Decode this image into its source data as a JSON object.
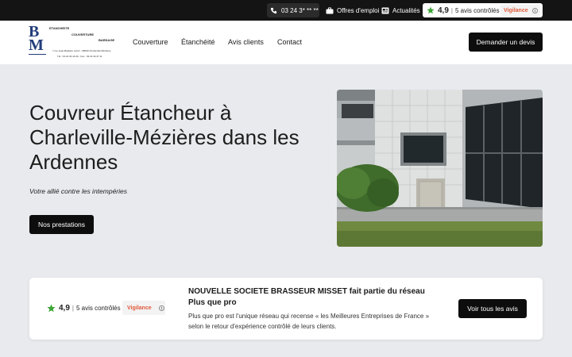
{
  "topbar": {
    "phone": "03 24 3* ** **",
    "jobs_label": "Offres d'emploi",
    "news_label": "Actualités",
    "rating_score": "4,9",
    "rating_count": "5 avis contrôlés",
    "vigilance_label": "Vigilance"
  },
  "header": {
    "logo": {
      "monogram": "BM",
      "line1": "ETANCHEITE",
      "line2": "COUVERTURE",
      "line3": "BARDAGE",
      "address": "7 rue Jean-Baptiste Lefort - 08000 Charleville-Mézières",
      "tel": "Tél : 03.24.33.40.40 - Fax : 03.24.33.47.11"
    },
    "nav": [
      "Couverture",
      "Étanchéité",
      "Avis clients",
      "Contact"
    ],
    "quote_button": "Demander un devis"
  },
  "hero": {
    "title": "Couvreur Étancheur à Charleville-Mézières dans les Ardennes",
    "subtitle": "Votre allié contre les intempéries",
    "button": "Nos prestations"
  },
  "network_card": {
    "rating_score": "4,9",
    "rating_count": "5 avis contrôlés",
    "vigilance_label": "Vigilance",
    "title": "NOUVELLE SOCIETE BRASSEUR MISSET fait partie du réseau Plus que pro",
    "text": "Plus que pro est l'unique réseau qui recense « les Meilleures Entreprises de France » selon le retour d'expérience contrôlé de leurs clients.",
    "button": "Voir tous les avis"
  },
  "colors": {
    "accent": "#0d0d0d",
    "topbar": "#141414",
    "rating_star": "#3aa534",
    "vigilance": "#e05a3a",
    "logo_blue": "#233d7a"
  }
}
